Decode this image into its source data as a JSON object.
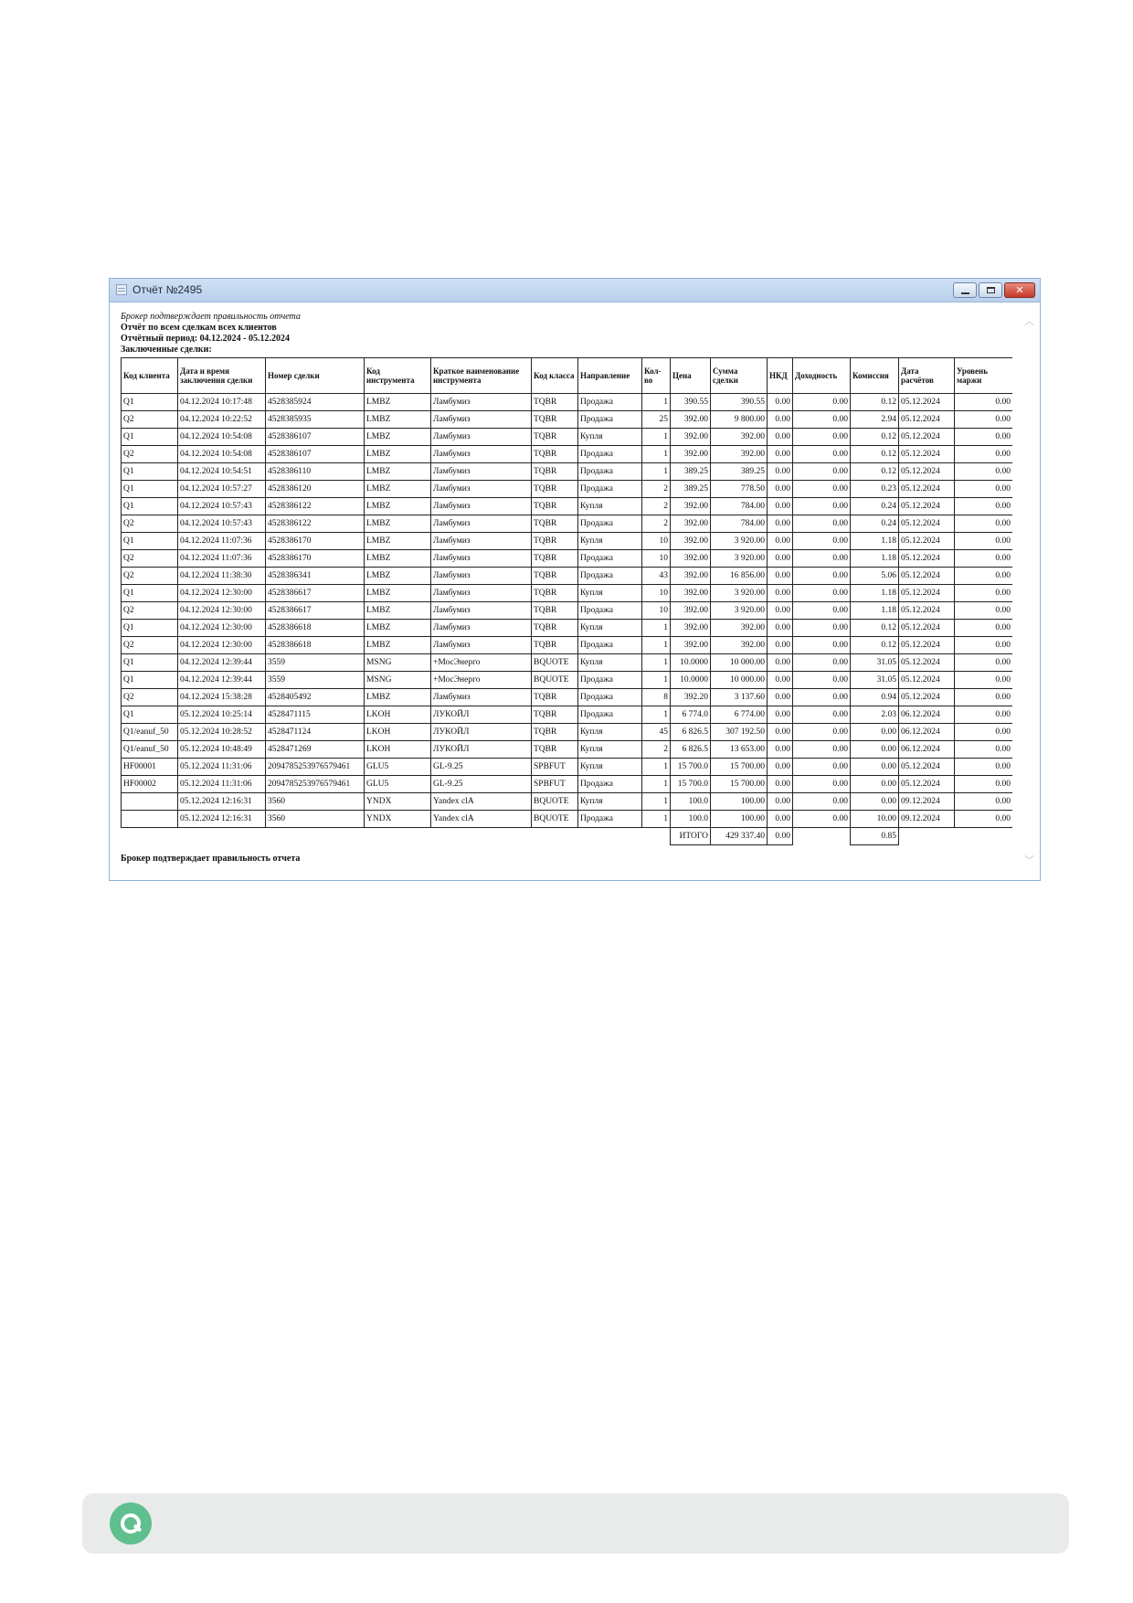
{
  "window": {
    "title": "Отчёт №2495"
  },
  "report": {
    "italic_note": "Брокер подтверждает правильность отчета",
    "heading": "Отчёт по всем сделкам всех клиентов",
    "period": "Отчётный период: 04.12.2024 - 05.12.2024",
    "section": "Заключенные сделки:",
    "footer_note": "Брокер подтверждает правильность отчета",
    "columns": [
      "Код клиента",
      "Дата и время заключения сделки",
      "Номер сделки",
      "Код инструмента",
      "Краткое наименование инструмента",
      "Код класса",
      "Направление",
      "Кол-во",
      "Цена",
      "Сумма сделки",
      "НКД",
      "Доходность",
      "Комиссия",
      "Дата расчётов",
      "Уровень маржи"
    ],
    "rows": [
      [
        "Q1",
        "04.12.2024 10:17:48",
        "4528385924",
        "LMBZ",
        "Ламбумиз",
        "TQBR",
        "Продажа",
        "1",
        "390.55",
        "390.55",
        "0.00",
        "0.00",
        "0.12",
        "05.12.2024",
        "0.00"
      ],
      [
        "Q2",
        "04.12.2024 10:22:52",
        "4528385935",
        "LMBZ",
        "Ламбумиз",
        "TQBR",
        "Продажа",
        "25",
        "392.00",
        "9 800.00",
        "0.00",
        "0.00",
        "2.94",
        "05.12.2024",
        "0.00"
      ],
      [
        "Q1",
        "04.12.2024 10:54:08",
        "4528386107",
        "LMBZ",
        "Ламбумиз",
        "TQBR",
        "Купля",
        "1",
        "392.00",
        "392.00",
        "0.00",
        "0.00",
        "0.12",
        "05.12.2024",
        "0.00"
      ],
      [
        "Q2",
        "04.12.2024 10:54:08",
        "4528386107",
        "LMBZ",
        "Ламбумиз",
        "TQBR",
        "Продажа",
        "1",
        "392.00",
        "392.00",
        "0.00",
        "0.00",
        "0.12",
        "05.12.2024",
        "0.00"
      ],
      [
        "Q1",
        "04.12.2024 10:54:51",
        "4528386110",
        "LMBZ",
        "Ламбумиз",
        "TQBR",
        "Продажа",
        "1",
        "389.25",
        "389.25",
        "0.00",
        "0.00",
        "0.12",
        "05.12.2024",
        "0.00"
      ],
      [
        "Q1",
        "04.12.2024 10:57:27",
        "4528386120",
        "LMBZ",
        "Ламбумиз",
        "TQBR",
        "Продажа",
        "2",
        "389.25",
        "778.50",
        "0.00",
        "0.00",
        "0.23",
        "05.12.2024",
        "0.00"
      ],
      [
        "Q1",
        "04.12.2024 10:57:43",
        "4528386122",
        "LMBZ",
        "Ламбумиз",
        "TQBR",
        "Купля",
        "2",
        "392.00",
        "784.00",
        "0.00",
        "0.00",
        "0.24",
        "05.12.2024",
        "0.00"
      ],
      [
        "Q2",
        "04.12.2024 10:57:43",
        "4528386122",
        "LMBZ",
        "Ламбумиз",
        "TQBR",
        "Продажа",
        "2",
        "392.00",
        "784.00",
        "0.00",
        "0.00",
        "0.24",
        "05.12.2024",
        "0.00"
      ],
      [
        "Q1",
        "04.12.2024 11:07:36",
        "4528386170",
        "LMBZ",
        "Ламбумиз",
        "TQBR",
        "Купля",
        "10",
        "392.00",
        "3 920.00",
        "0.00",
        "0.00",
        "1.18",
        "05.12.2024",
        "0.00"
      ],
      [
        "Q2",
        "04.12.2024 11:07:36",
        "4528386170",
        "LMBZ",
        "Ламбумиз",
        "TQBR",
        "Продажа",
        "10",
        "392.00",
        "3 920.00",
        "0.00",
        "0.00",
        "1.18",
        "05.12.2024",
        "0.00"
      ],
      [
        "Q2",
        "04.12.2024 11:38:30",
        "4528386341",
        "LMBZ",
        "Ламбумиз",
        "TQBR",
        "Продажа",
        "43",
        "392.00",
        "16 856.00",
        "0.00",
        "0.00",
        "5.06",
        "05.12.2024",
        "0.00"
      ],
      [
        "Q1",
        "04.12.2024 12:30:00",
        "4528386617",
        "LMBZ",
        "Ламбумиз",
        "TQBR",
        "Купля",
        "10",
        "392.00",
        "3 920.00",
        "0.00",
        "0.00",
        "1.18",
        "05.12.2024",
        "0.00"
      ],
      [
        "Q2",
        "04.12.2024 12:30:00",
        "4528386617",
        "LMBZ",
        "Ламбумиз",
        "TQBR",
        "Продажа",
        "10",
        "392.00",
        "3 920.00",
        "0.00",
        "0.00",
        "1.18",
        "05.12.2024",
        "0.00"
      ],
      [
        "Q1",
        "04.12.2024 12:30:00",
        "4528386618",
        "LMBZ",
        "Ламбумиз",
        "TQBR",
        "Купля",
        "1",
        "392.00",
        "392.00",
        "0.00",
        "0.00",
        "0.12",
        "05.12.2024",
        "0.00"
      ],
      [
        "Q2",
        "04.12.2024 12:30:00",
        "4528386618",
        "LMBZ",
        "Ламбумиз",
        "TQBR",
        "Продажа",
        "1",
        "392.00",
        "392.00",
        "0.00",
        "0.00",
        "0.12",
        "05.12.2024",
        "0.00"
      ],
      [
        "Q1",
        "04.12.2024 12:39:44",
        "3559",
        "MSNG",
        "+МосЭнерго",
        "BQUOTE",
        "Купля",
        "1",
        "10.0000",
        "10 000.00",
        "0.00",
        "0.00",
        "31.05",
        "05.12.2024",
        "0.00"
      ],
      [
        "Q1",
        "04.12.2024 12:39:44",
        "3559",
        "MSNG",
        "+МосЭнерго",
        "BQUOTE",
        "Продажа",
        "1",
        "10.0000",
        "10 000.00",
        "0.00",
        "0.00",
        "31.05",
        "05.12.2024",
        "0.00"
      ],
      [
        "Q2",
        "04.12.2024 15:38:28",
        "4528405492",
        "LMBZ",
        "Ламбумиз",
        "TQBR",
        "Продажа",
        "8",
        "392.20",
        "3 137.60",
        "0.00",
        "0.00",
        "0.94",
        "05.12.2024",
        "0.00"
      ],
      [
        "Q1",
        "05.12.2024 10:25:14",
        "4528471115",
        "LKOH",
        "ЛУКОЙЛ",
        "TQBR",
        "Продажа",
        "1",
        "6 774.0",
        "6 774.00",
        "0.00",
        "0.00",
        "2.03",
        "06.12.2024",
        "0.00"
      ],
      [
        "Q1/eanuf_50",
        "05.12.2024 10:28:52",
        "4528471124",
        "LKOH",
        "ЛУКОЙЛ",
        "TQBR",
        "Купля",
        "45",
        "6 826.5",
        "307 192.50",
        "0.00",
        "0.00",
        "0.00",
        "06.12.2024",
        "0.00"
      ],
      [
        "Q1/eanuf_50",
        "05.12.2024 10:48:49",
        "4528471269",
        "LKOH",
        "ЛУКОЙЛ",
        "TQBR",
        "Купля",
        "2",
        "6 826.5",
        "13 653.00",
        "0.00",
        "0.00",
        "0.00",
        "06.12.2024",
        "0.00"
      ],
      [
        "HF00001",
        "05.12.2024 11:31:06",
        "2094785253976579461",
        "GLU5",
        "GL-9.25",
        "SPBFUT",
        "Купля",
        "1",
        "15 700.0",
        "15 700.00",
        "0.00",
        "0.00",
        "0.00",
        "05.12.2024",
        "0.00"
      ],
      [
        "HF00002",
        "05.12.2024 11:31:06",
        "2094785253976579461",
        "GLU5",
        "GL-9.25",
        "SPBFUT",
        "Продажа",
        "1",
        "15 700.0",
        "15 700.00",
        "0.00",
        "0.00",
        "0.00",
        "05.12.2024",
        "0.00"
      ],
      [
        "",
        "05.12.2024 12:16:31",
        "3560",
        "YNDX",
        "Yandex clA",
        "BQUOTE",
        "Купля",
        "1",
        "100.0",
        "100.00",
        "0.00",
        "0.00",
        "0.00",
        "09.12.2024",
        "0.00"
      ],
      [
        "",
        "05.12.2024 12:16:31",
        "3560",
        "YNDX",
        "Yandex clA",
        "BQUOTE",
        "Продажа",
        "1",
        "100.0",
        "100.00",
        "0.00",
        "0.00",
        "10.00",
        "09.12.2024",
        "0.00"
      ]
    ],
    "total": {
      "label": "ИТОГО",
      "sum": "429 337.40",
      "nkd": "0.00",
      "commission": "0.85"
    }
  },
  "icons": {
    "window_icon": "table-icon",
    "minimize": "minimize-icon",
    "maximize": "maximize-icon",
    "close": "close-icon",
    "scroll_up": "chevron-up-icon",
    "scroll_down": "chevron-down-icon",
    "logo": "search-logo-icon"
  },
  "colors": {
    "titlebar": "#c3d7ef",
    "close_button": "#c4382a",
    "logo_green": "#5fbf8f",
    "bottom_bar": "#e9ebea"
  }
}
